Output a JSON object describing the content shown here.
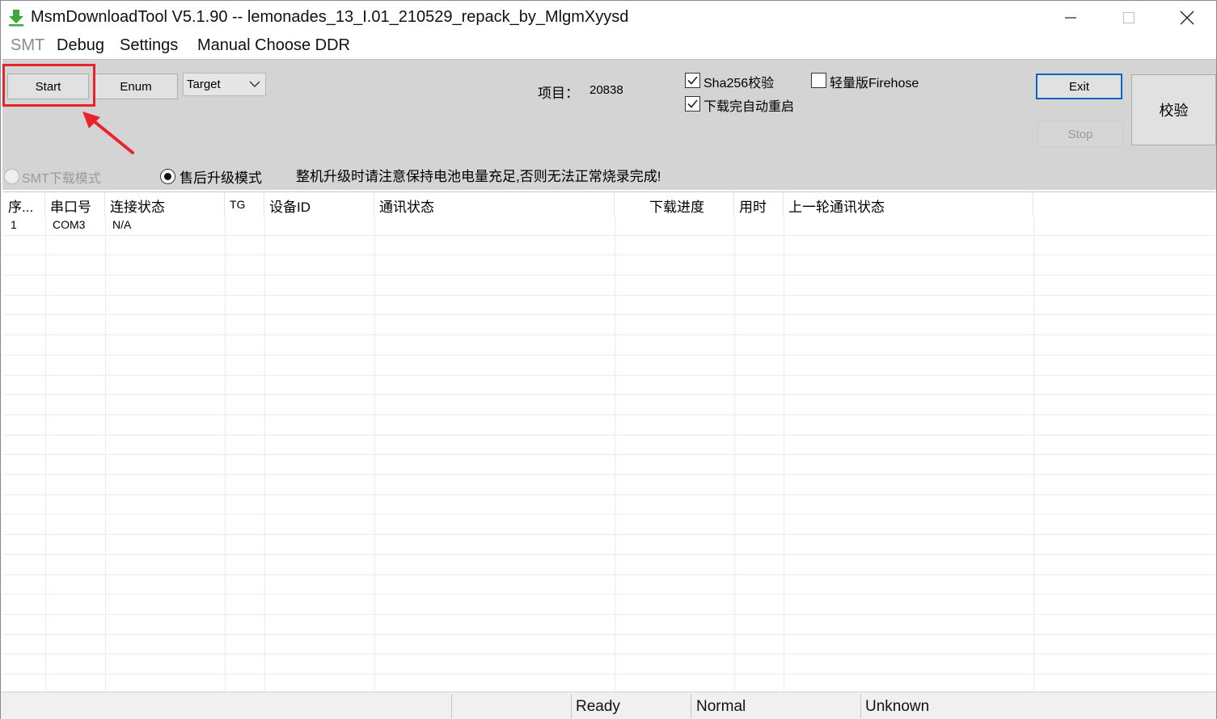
{
  "window": {
    "title": "MsmDownloadTool V5.1.90 -- lemonades_13_I.01_210529_repack_by_MlgmXyysd"
  },
  "menu": [
    "SMT",
    "Debug",
    "Settings",
    "Manual Choose DDR"
  ],
  "toolbar": {
    "start_label": "Start",
    "enum_label": "Enum",
    "target_value": "Target",
    "project_label": "项目：",
    "project_value": "20838",
    "sha256_label": "Sha256校验",
    "sha256_checked": true,
    "lite_firehose_label": "轻量版Firehose",
    "lite_firehose_checked": false,
    "auto_reboot_label": "下载完自动重启",
    "auto_reboot_checked": true,
    "exit_label": "Exit",
    "stop_label": "Stop",
    "verify_label": "校验"
  },
  "mode": {
    "smt_label": "SMT下载模式",
    "after_sales_label": "售后升级模式",
    "selected": "after_sales",
    "warning": "整机升级时请注意保持电池电量充足,否则无法正常烧录完成!"
  },
  "table": {
    "columns": [
      "序...",
      "串口号",
      "连接状态",
      "TG",
      "设备ID",
      "通讯状态",
      "下载进度",
      "用时",
      "上一轮通讯状态"
    ],
    "rows": [
      [
        "1",
        "COM3",
        "N/A",
        "",
        "",
        "",
        "",
        "",
        ""
      ]
    ]
  },
  "statusbar": {
    "state": "Ready",
    "mode": "Normal",
    "device": "Unknown"
  },
  "colors": {
    "toolbar_bg": "#d4d4d4",
    "highlight": "#e8242a",
    "default_button_border": "#0a64c8",
    "icon_green": "#3aa83a"
  }
}
